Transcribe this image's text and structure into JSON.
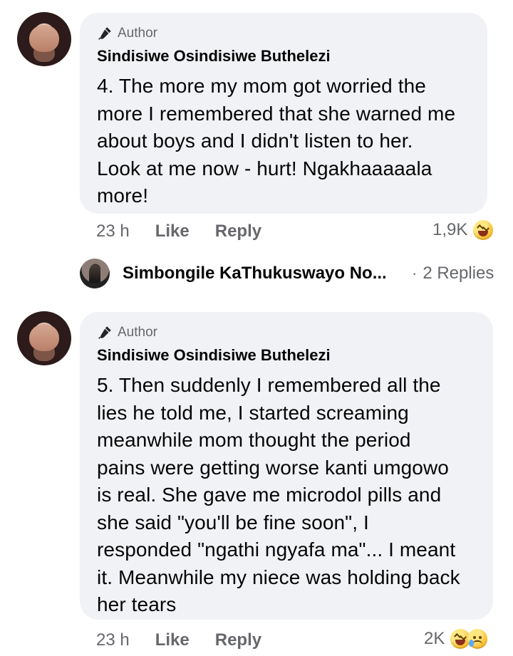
{
  "comments": [
    {
      "author_badge": "Author",
      "name": "Sindisiwe Osindisiwe Buthelezi",
      "text": "4. The more my mom got worried the\nmore I remembered that she warned me\nabout boys and I didn't listen to her.\nLook at me now - hurt! Ngakhaaaaala\nmore!",
      "time": "23 h",
      "like_label": "Like",
      "reply_label": "Reply",
      "reaction_count": "1,9K",
      "reactions": [
        "laugh-icon"
      ]
    },
    {
      "author_badge": "Author",
      "name": "Sindisiwe Osindisiwe Buthelezi",
      "text": "5. Then suddenly I remembered all the\nlies he told me, I started screaming\nmeanwhile mom thought the period\npains were getting worse kanti umgowo\nis real. She gave me microdol pills and\nshe said \"you'll be fine soon\", I\nresponded \"ngathi ngyafa ma\"... I meant\nit. Meanwhile my niece was holding back\nher tears",
      "time": "23 h",
      "like_label": "Like",
      "reply_label": "Reply",
      "reaction_count": "2K",
      "reactions": [
        "laugh-icon",
        "sad-icon"
      ]
    }
  ],
  "replies_preview": {
    "name": "Simbongile KaThukuswayo No...",
    "count_label": "2 Replies"
  },
  "colors": {
    "bubble": "#f0f2f5",
    "meta": "#65676b",
    "text": "#050505",
    "reaction_yellow": "#f7b928"
  }
}
